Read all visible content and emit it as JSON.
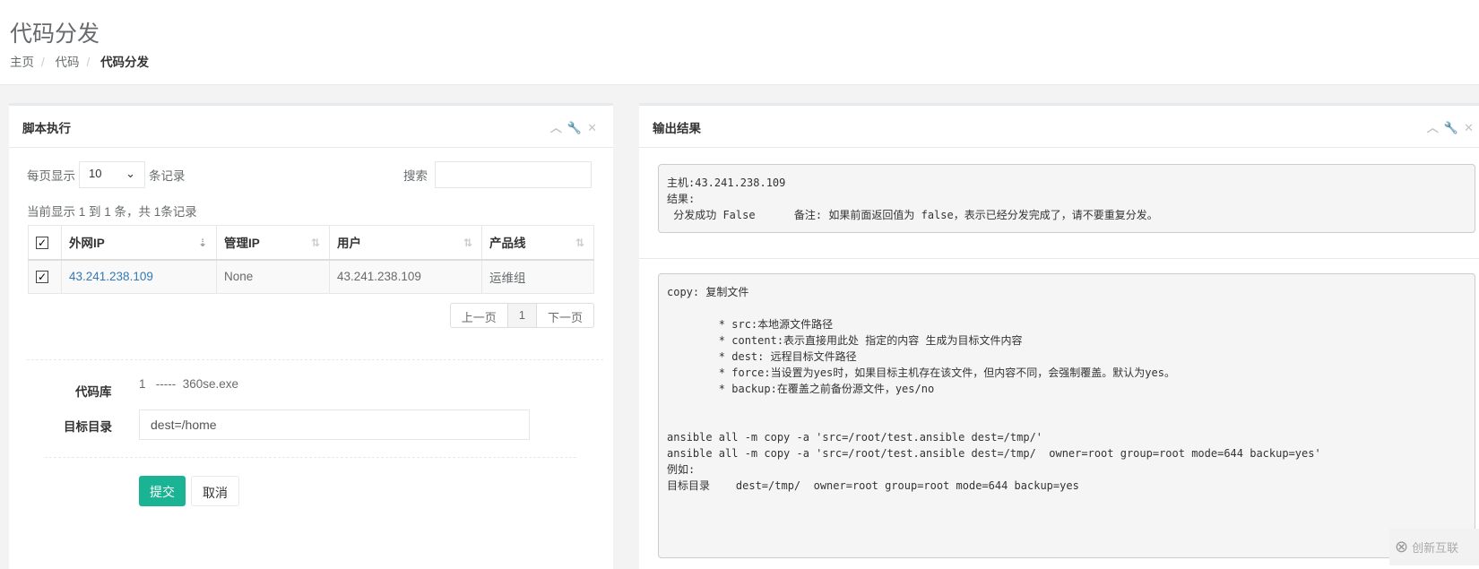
{
  "page": {
    "title": "代码分发",
    "breadcrumb": [
      "主页",
      "代码",
      "代码分发"
    ]
  },
  "left": {
    "title": "脚本执行",
    "per_page_label": "每页显示",
    "per_page_value": "10",
    "records_label": "条记录",
    "search_label": "搜索",
    "search_value": "",
    "info": "当前显示 1 到 1 条，共 1条记录",
    "columns": [
      "外网IP",
      "管理IP",
      "用户",
      "产品线"
    ],
    "rows": [
      {
        "checked": true,
        "ip": "43.241.238.109",
        "mgmt": "None",
        "user": "43.241.238.109",
        "line": "运维组"
      }
    ],
    "pagination": {
      "prev": "上一页",
      "current": "1",
      "next": "下一页"
    },
    "repo_label": "代码库",
    "repo_value": "1   -----  360se.exe",
    "dest_label": "目标目录",
    "dest_value": "dest=/home",
    "submit": "提交",
    "cancel": "取消"
  },
  "right": {
    "title": "输出结果",
    "result": "主机:43.241.238.109\n结果:\n 分发成功 False      备注: 如果前面返回值为 false，表示已经分发完成了，请不要重复分发。",
    "help": "copy: 复制文件\n\n        * src:本地源文件路径\n        * content:表示直接用此处 指定的内容 生成为目标文件内容\n        * dest: 远程目标文件路径\n        * force:当设置为yes时，如果目标主机存在该文件，但内容不同，会强制覆盖。默认为yes。\n        * backup:在覆盖之前备份源文件，yes/no\n\n\nansible all -m copy -a 'src=/root/test.ansible dest=/tmp/'\nansible all -m copy -a 'src=/root/test.ansible dest=/tmp/  owner=root group=root mode=644 backup=yes'\n例如:\n目标目录    dest=/tmp/  owner=root group=root mode=644 backup=yes"
  },
  "watermark": "创新互联",
  "colors": {
    "primary": "#1ab394",
    "link": "#337ab7"
  }
}
